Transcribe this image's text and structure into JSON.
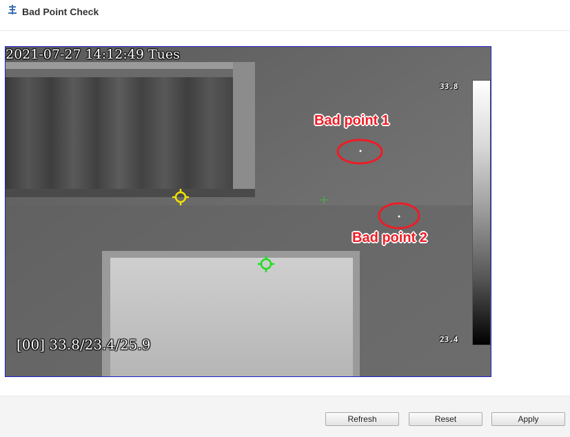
{
  "header": {
    "title": "Bad Point Check",
    "icon": "settings-wrench-icon"
  },
  "video": {
    "datetime": "2021-07-27 14:12:49 Tues",
    "temps_readout": "[00] 33.8/23.4/25.9",
    "scale_max": "33.8",
    "scale_min": "23.4",
    "annotations": {
      "bad_point_1": "Bad point 1",
      "bad_point_2": "Bad point 2"
    },
    "colors": {
      "frame_border": "#1c1fc8",
      "annotation_red": "#ee1c25",
      "max_marker": "#f5e400",
      "min_marker": "#19e019",
      "center_marker": "#3fbf3f"
    }
  },
  "buttons": {
    "refresh": "Refresh",
    "reset": "Reset",
    "apply": "Apply"
  }
}
